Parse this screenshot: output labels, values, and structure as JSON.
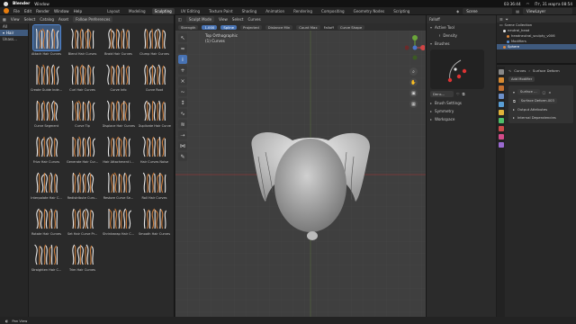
{
  "os_bar": {
    "app_name": "Blender",
    "menus": [
      "Window"
    ],
    "time": "03:36:44",
    "date_time": "Пт, 31 марта 08:54"
  },
  "top_bar": {
    "menus": [
      "File",
      "Edit",
      "Render",
      "Window",
      "Help"
    ],
    "workspaces": [
      "Layout",
      "Modeling",
      "Sculpting",
      "UV Editing",
      "Texture Paint",
      "Shading",
      "Animation",
      "Rendering",
      "Compositing",
      "Geometry Nodes",
      "Scripting"
    ],
    "active_workspace": "Sculpting",
    "scene": "Scene",
    "view_layer": "ViewLayer"
  },
  "asset_browser": {
    "header": [
      "View",
      "Select",
      "Catalog",
      "Asset"
    ],
    "library": "Follow Preferences",
    "sidebar": [
      {
        "label": "All",
        "selected": false
      },
      {
        "label": "Hair",
        "selected": true
      },
      {
        "label": "Unass...",
        "selected": false
      }
    ],
    "assets": [
      "Attach Hair Curves",
      "Blend Hair Curves",
      "Braid Hair Curves",
      "Clump Hair Curves",
      "Create Guide Inde...",
      "Curl Hair Curves",
      "Curve Info",
      "Curve Root",
      "Curve Segment",
      "Curve Tip",
      "Displace Hair Curves",
      "Duplicate Hair Curves",
      "Frizz Hair Curves",
      "Generate Hair Cur...",
      "Hair Attachment I...",
      "Hair Curves Noise",
      "Interpolate Hair C...",
      "Redistribute Curv...",
      "Restore Curve Se...",
      "Roll Hair Curves",
      "Rotate Hair Curves",
      "Set Hair Curve Pr...",
      "Shrinkwrap Hair C...",
      "Smooth Hair Curves",
      "Straighten Hair C...",
      "Trim Hair Curves"
    ],
    "selected_index": 0
  },
  "viewport": {
    "header": [
      "View",
      "Select",
      "Curves"
    ],
    "mode": "Sculpt Mode",
    "tool_settings": {
      "strength_label": "Strength",
      "strength_value": "1.000",
      "falloff_label": "Falloff",
      "spline_label": "Spline",
      "projected_label": "Projected",
      "distance_min_label": "Distance Min",
      "count_max_label": "Count Max",
      "curve_shape_label": "Curve Shape"
    },
    "overlay_title": "Top Orthographic",
    "overlay_sub": "(1) Curves",
    "gizmo": {
      "x": "X",
      "y": "Y",
      "z": "Z"
    }
  },
  "n_panel": {
    "tabs": [
      "Tool",
      "View",
      "Edit"
    ],
    "active_tool": "Active Tool",
    "density": "Density",
    "brushes": "Brushes",
    "brush_name": "Dens...",
    "sections": [
      "Brush Settings",
      "Symmetry",
      "Workspace"
    ]
  },
  "outliner": {
    "items": [
      {
        "label": "Scene Collection",
        "level": 0,
        "selected": false
      },
      {
        "label": "neutral_head",
        "level": 1,
        "selected": false
      },
      {
        "label": "headneutral_sculpty_v006",
        "level": 2,
        "selected": false
      },
      {
        "label": "Modifiers",
        "level": 2,
        "selected": false
      },
      {
        "label": "Sphere",
        "level": 1,
        "selected": true
      }
    ]
  },
  "properties": {
    "object": "Curves",
    "modifier_breadcrumb": "Surface Deform",
    "add_modifier": "Add Modifier",
    "modifier_type": "Surface ...",
    "modifier_name": "Surface Deform.003",
    "output_attributes": "Output Attributes",
    "internal_dependencies": "Internal Dependencies",
    "tab_colors": [
      "#888888",
      "#d78a32",
      "#c46f2f",
      "#6c8fc9",
      "#5a9fd6",
      "#e2b33a",
      "#4fbf6a",
      "#cc4a4a",
      "#d34b8a",
      "#9a6ad0"
    ]
  },
  "status_bar": {
    "text": "Pan View"
  },
  "colors": {
    "accent": "#4772b3",
    "hair_orange": "#c87a3a",
    "selection": "#3f5a7e"
  }
}
